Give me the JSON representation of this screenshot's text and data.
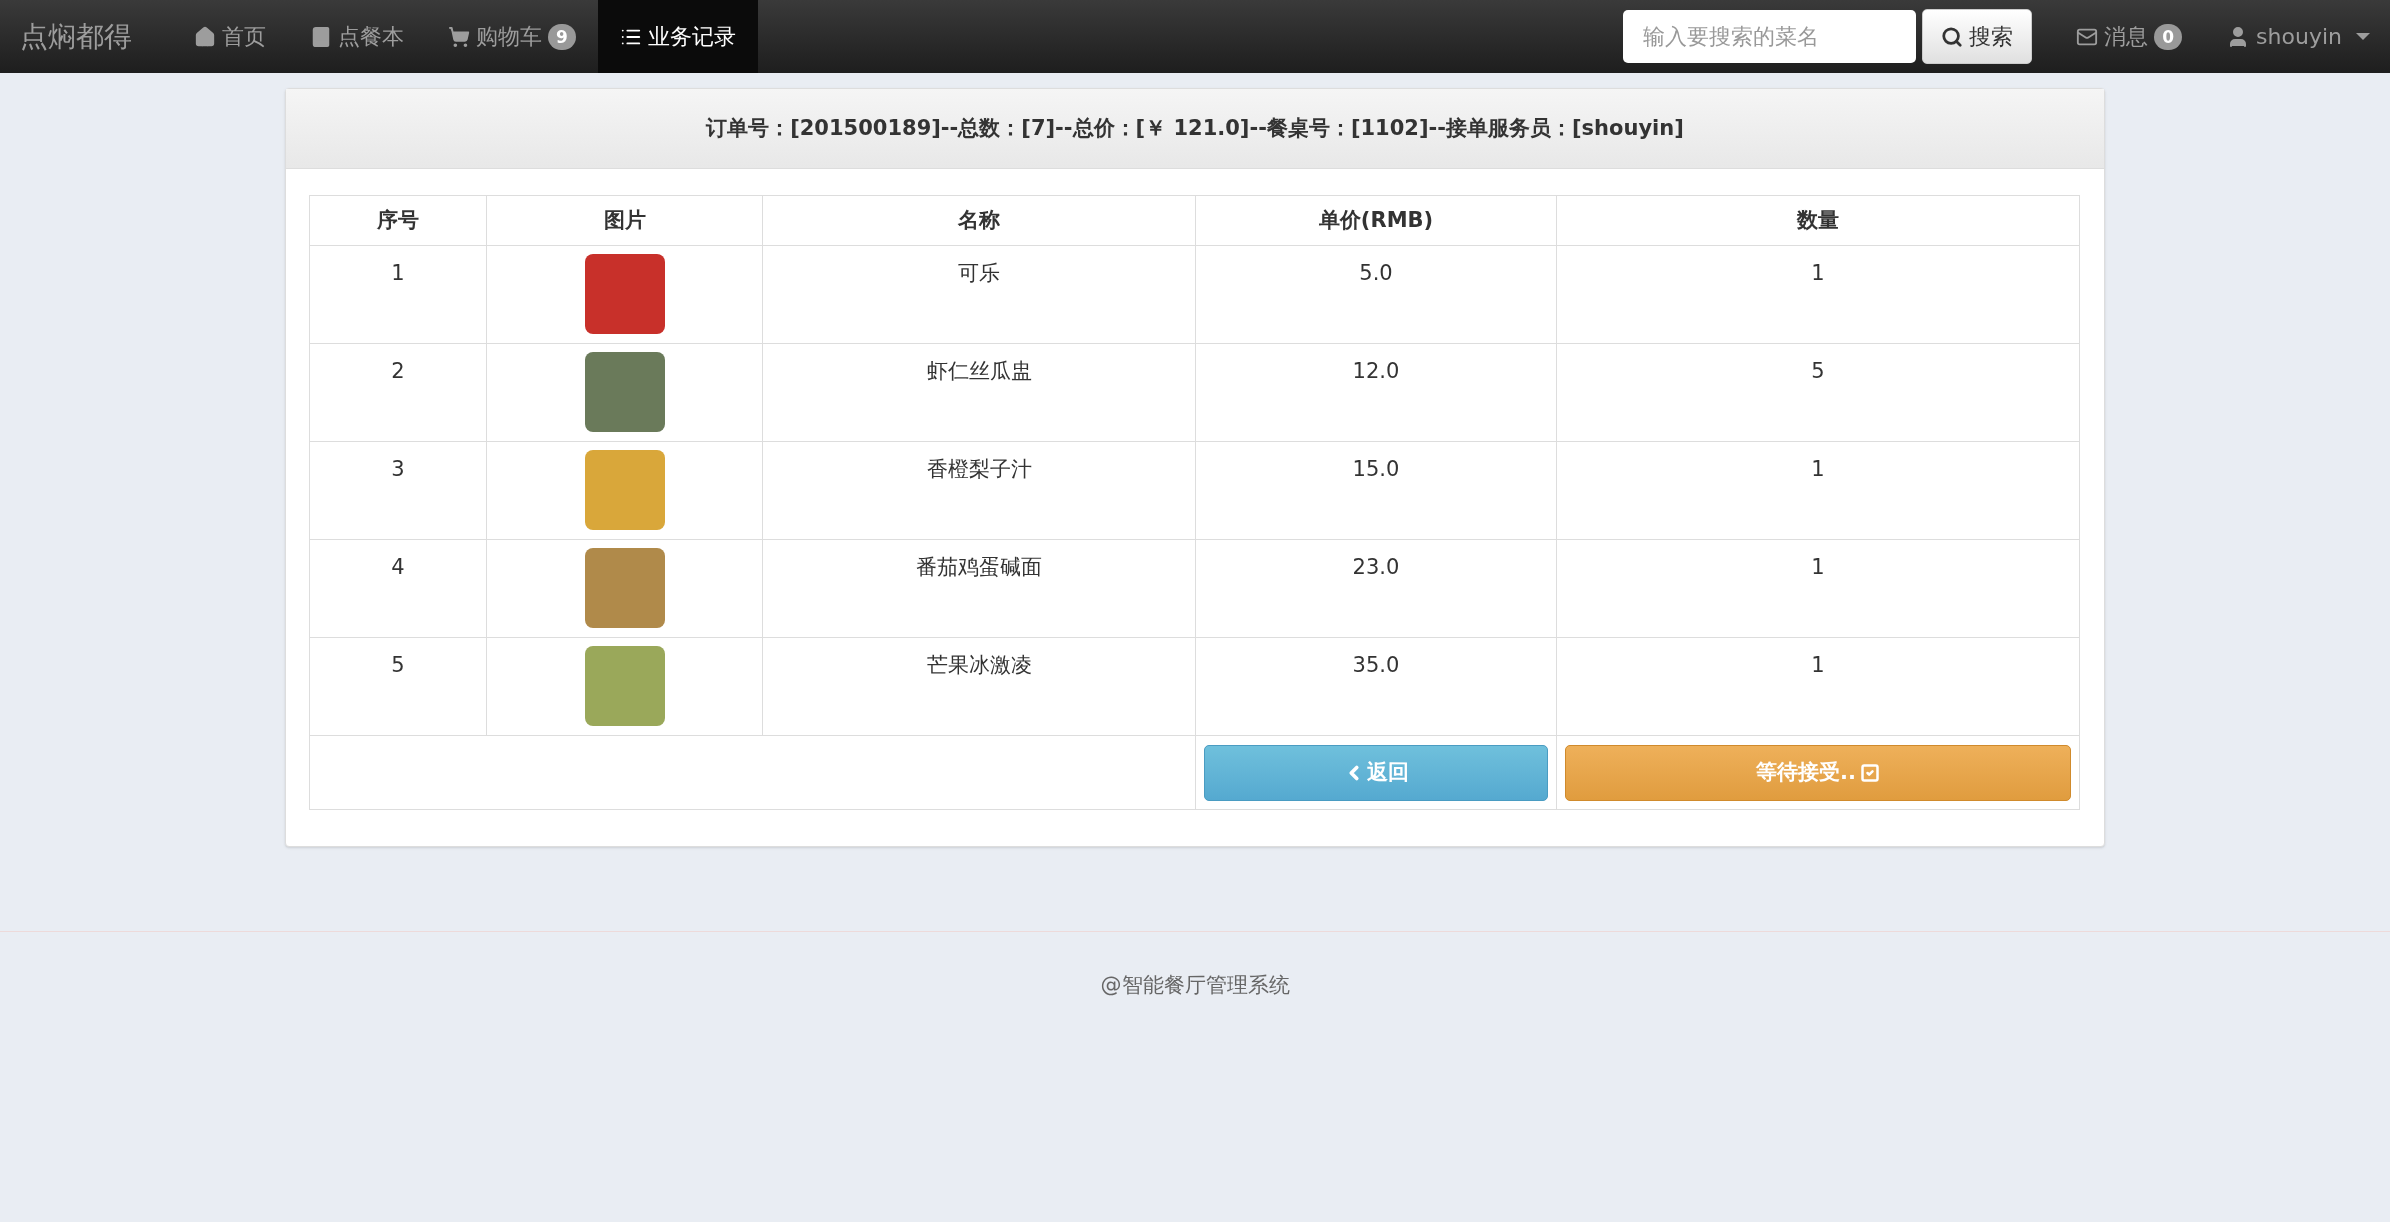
{
  "navbar": {
    "brand": "点焖都得",
    "items": [
      {
        "label": "首页",
        "selected": false
      },
      {
        "label": "点餐本",
        "selected": false
      },
      {
        "label": "购物车",
        "badge": "9",
        "selected": false
      },
      {
        "label": "业务记录",
        "selected": true
      }
    ],
    "search": {
      "placeholder": "输入要搜索的菜名",
      "button": "搜索"
    },
    "messages": {
      "label": "消息",
      "badge": "0"
    },
    "user": {
      "name": "shouyin"
    }
  },
  "order": {
    "summary": "订单号：[201500189]--总数：[7]--总价：[￥ 121.0]--餐桌号：[1102]--接单服务员：[shouyin]",
    "columns": [
      "序号",
      "图片",
      "名称",
      "单价(RMB)",
      "数量"
    ],
    "rows": [
      {
        "index": "1",
        "name": "可乐",
        "price": "5.0",
        "quantity": "1"
      },
      {
        "index": "2",
        "name": "虾仁丝瓜盅",
        "price": "12.0",
        "quantity": "5"
      },
      {
        "index": "3",
        "name": "香橙梨子汁",
        "price": "15.0",
        "quantity": "1"
      },
      {
        "index": "4",
        "name": "番茄鸡蛋碱面",
        "price": "23.0",
        "quantity": "1"
      },
      {
        "index": "5",
        "name": "芒果冰激凌",
        "price": "35.0",
        "quantity": "1"
      }
    ],
    "back_button": "返回",
    "status_button": "等待接受.."
  },
  "footer": "@智能餐厅管理系统"
}
